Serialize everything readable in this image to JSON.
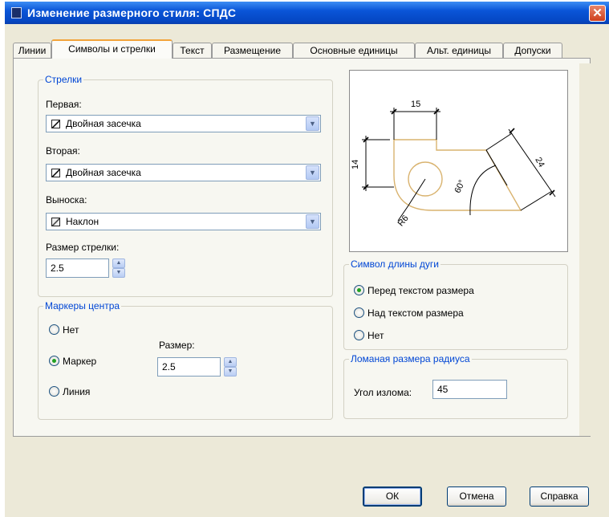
{
  "window": {
    "title": "Изменение размерного стиля: СПДС"
  },
  "tabs": [
    "Линии",
    "Символы и стрелки",
    "Текст",
    "Размещение",
    "Основные единицы",
    "Альт. единицы",
    "Допуски"
  ],
  "arrows": {
    "legend": "Стрелки",
    "first_label": "Первая:",
    "first_value": "Двойная засечка",
    "second_label": "Вторая:",
    "second_value": "Двойная засечка",
    "leader_label": "Выноска:",
    "leader_value": "Наклон",
    "size_label": "Размер стрелки:",
    "size_value": "2.5"
  },
  "center_marks": {
    "legend": "Маркеры центра",
    "options": [
      "Нет",
      "Маркер",
      "Линия"
    ],
    "selected": "Маркер",
    "size_label": "Размер:",
    "size_value": "2.5"
  },
  "preview": {
    "dim_top": "15",
    "dim_left": "14",
    "dim_right": "24",
    "dim_angle": "60°",
    "dim_radius": "R6"
  },
  "arc_length": {
    "legend": "Символ длины дуги",
    "options": [
      "Перед текстом размера",
      "Над текстом размера",
      "Нет"
    ],
    "selected": "Перед текстом размера"
  },
  "radius_jog": {
    "legend": "Ломаная размера радиуса",
    "angle_label": "Угол излома:",
    "angle_value": "45"
  },
  "buttons": {
    "ok": "ОК",
    "cancel": "Отмена",
    "help": "Справка"
  },
  "colors": {
    "accent": "#0046d5",
    "titlebar": "#0a55d8",
    "preview_shape": "#d9b36f"
  }
}
